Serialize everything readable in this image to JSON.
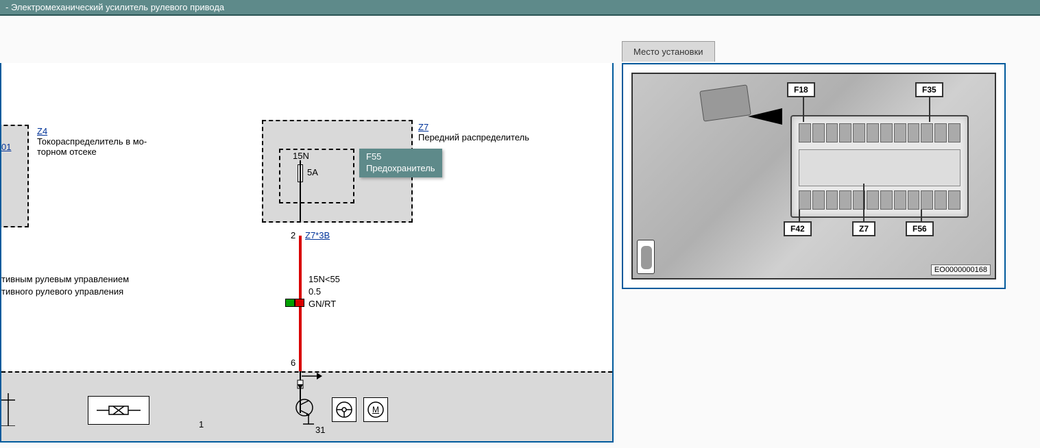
{
  "header": {
    "title": "-  Электромеханический усилитель рулевого привода"
  },
  "right": {
    "tab_label": "Место установки",
    "callouts": {
      "f18": "F18",
      "f35": "F35",
      "f42": "F42",
      "z7": "Z7",
      "f56": "F56"
    },
    "image_id": "EO0000000168"
  },
  "schematic": {
    "z4": {
      "link": "Z4",
      "desc": "Токораспределитель в мо-\nторном отсеке"
    },
    "link_01": "01",
    "z7": {
      "link": "Z7",
      "desc": "Передний распределитель"
    },
    "fuse": {
      "terminal": "15N",
      "rating": "5A"
    },
    "tooltip": "F55\nПредохранитель",
    "pin_top": "2",
    "conn_top": "Z7*3B",
    "wire": {
      "signal": "15N<55",
      "gauge": "0.5",
      "color": "GN/RT"
    },
    "pin_bottom": "6",
    "gnd": "31",
    "box_num": "1",
    "text_frag1": "тивным рулевым управлением",
    "text_frag2": "тивного рулевого управления",
    "motor_letter": "M"
  }
}
